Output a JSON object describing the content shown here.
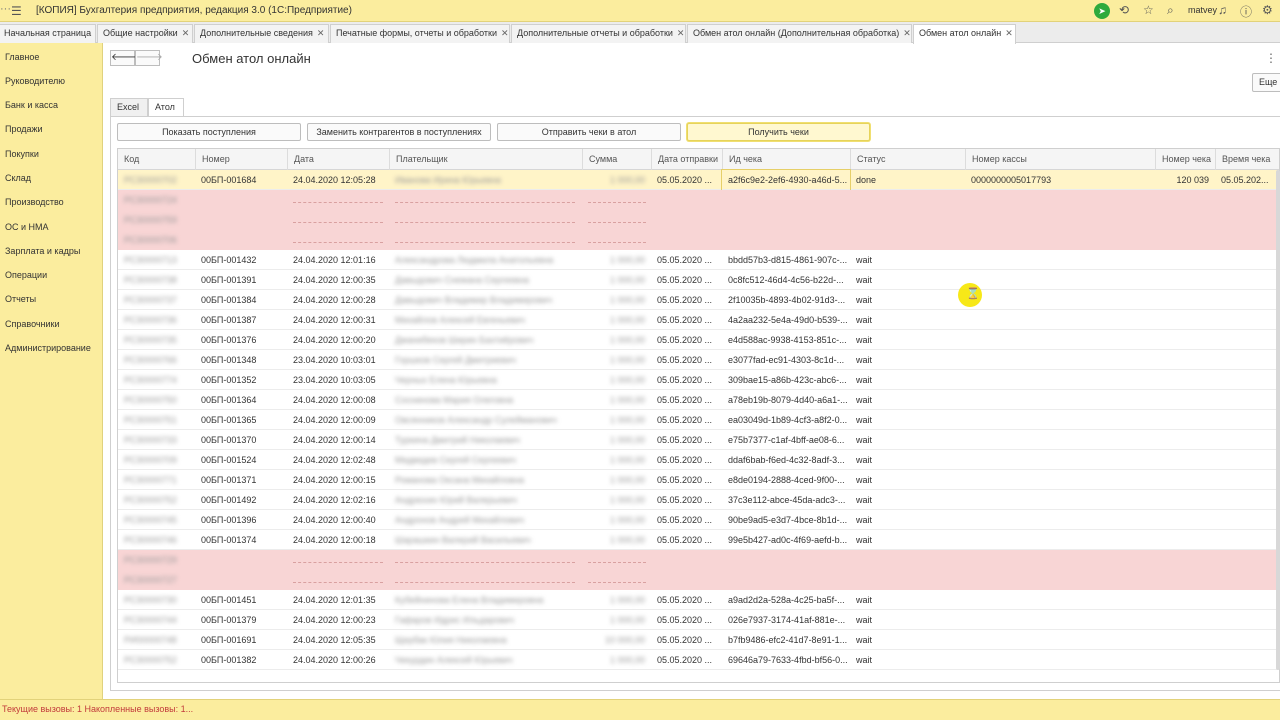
{
  "app": {
    "title": "[КОПИЯ] Бухгалтерия предприятия, редакция 3.0  (1С:Предприятие)",
    "user": "matvey"
  },
  "tabs": [
    {
      "label": "Начальная страница",
      "closable": false
    },
    {
      "label": "Общие настройки",
      "closable": true
    },
    {
      "label": "Дополнительные сведения",
      "closable": true
    },
    {
      "label": "Печатные формы, отчеты и обработки",
      "closable": true
    },
    {
      "label": "Дополнительные отчеты и обработки",
      "closable": true
    },
    {
      "label": "Обмен атол онлайн (Дополнительная обработка)",
      "closable": true
    },
    {
      "label": "Обмен атол онлайн",
      "closable": true,
      "active": true
    }
  ],
  "sidebar": {
    "items": [
      "Главное",
      "Руководителю",
      "Банк и касса",
      "Продажи",
      "Покупки",
      "Склад",
      "Производство",
      "ОС и НМА",
      "Зарплата и кадры",
      "Операции",
      "Отчеты",
      "Справочники",
      "Администрирование"
    ]
  },
  "page": {
    "title": "Обмен атол онлайн",
    "more_label": "Еще"
  },
  "page_tabs": [
    "Excel",
    "Атол"
  ],
  "actions": {
    "show": "Показать поступления",
    "replace": "Заменить контрагентов в поступлениях",
    "send": "Отправить чеки в атол",
    "get": "Получить чеки"
  },
  "table": {
    "columns": [
      "Код",
      "Номер",
      "Дата",
      "Плательщик",
      "Сумма",
      "Дата отправки",
      "Ид чека",
      "Статус",
      "Номер кассы",
      "Номер чека",
      "Время чека"
    ],
    "rows": [
      {
        "code": "РСЗ0000702",
        "num": "00БП-001684",
        "date": "24.04.2020 12:05:28",
        "payer": "Иванова Ирина Юрьевна",
        "sum": "1 000,00",
        "sent": "05.05.2020 ...",
        "id": "a2f6c9e2-2ef6-4930-a46d-5...",
        "status": "done",
        "kassa": "0000000005017793",
        "chek": "120 039",
        "time": "05.05.202...",
        "selected": true
      },
      {
        "kind": "red",
        "codes": [
          "РСЗ0000724",
          "РСЗ0000759",
          "РСЗ0000706"
        ]
      },
      {
        "code": "РСЗ0000713",
        "num": "00БП-001432",
        "date": "24.04.2020 12:01:16",
        "payer": "Александрова Людмила Анатольевна",
        "sum": "1 000,00",
        "sent": "05.05.2020 ...",
        "id": "bbdd57b3-d815-4861-907c-...",
        "status": "wait"
      },
      {
        "code": "РСЗ0000738",
        "num": "00БП-001391",
        "date": "24.04.2020 12:00:35",
        "payer": "Давыдович Снежана Сергеевна",
        "sum": "1 000,00",
        "sent": "05.05.2020 ...",
        "id": "0c8fc512-46d4-4c56-b22d-...",
        "status": "wait"
      },
      {
        "code": "РСЗ0000737",
        "num": "00БП-001384",
        "date": "24.04.2020 12:00:28",
        "payer": "Давыдович Владимир Владимирович",
        "sum": "1 000,00",
        "sent": "05.05.2020 ...",
        "id": "2f10035b-4893-4b02-91d3-...",
        "status": "wait"
      },
      {
        "code": "РСЗ0000736",
        "num": "00БП-001387",
        "date": "24.04.2020 12:00:31",
        "payer": "Михайлов Алексей Евгеньевич",
        "sum": "1 000,00",
        "sent": "05.05.2020 ...",
        "id": "4a2aa232-5e4a-49d0-b539-...",
        "status": "wait"
      },
      {
        "code": "РСЗ0000735",
        "num": "00БП-001376",
        "date": "24.04.2020 12:00:20",
        "payer": "Джанибеков Ширин Бахтиёрович",
        "sum": "1 000,00",
        "sent": "05.05.2020 ...",
        "id": "e4d588ac-9938-4153-851c-...",
        "status": "wait"
      },
      {
        "code": "РСЗ0000766",
        "num": "00БП-001348",
        "date": "23.04.2020 10:03:01",
        "payer": "Горшков Сергей Дмитриевич",
        "sum": "1 000,00",
        "sent": "05.05.2020 ...",
        "id": "e3077fad-ec91-4303-8c1d-...",
        "status": "wait"
      },
      {
        "code": "РСЗ0000774",
        "num": "00БП-001352",
        "date": "23.04.2020 10:03:05",
        "payer": "Черных Елена Юрьевна",
        "sum": "1 000,00",
        "sent": "05.05.2020 ...",
        "id": "309bae15-a86b-423c-abc6-...",
        "status": "wait"
      },
      {
        "code": "РСЗ0000750",
        "num": "00БП-001364",
        "date": "24.04.2020 12:00:08",
        "payer": "Соснинова Мария Олеговна",
        "sum": "1 000,00",
        "sent": "05.05.2020 ...",
        "id": "a78eb19b-8079-4d40-a6a1-...",
        "status": "wait"
      },
      {
        "code": "РСЗ0000751",
        "num": "00БП-001365",
        "date": "24.04.2020 12:00:09",
        "payer": "Овсянников Александр Сулейманович",
        "sum": "1 000,00",
        "sent": "05.05.2020 ...",
        "id": "ea03049d-1b89-4cf3-a8f2-0...",
        "status": "wait"
      },
      {
        "code": "РСЗ0000733",
        "num": "00БП-001370",
        "date": "24.04.2020 12:00:14",
        "payer": "Туркина Дмитрий Николаевич",
        "sum": "1 000,00",
        "sent": "05.05.2020 ...",
        "id": "e75b7377-c1af-4bff-ae08-6...",
        "status": "wait"
      },
      {
        "code": "РСЗ0000709",
        "num": "00БП-001524",
        "date": "24.04.2020 12:02:48",
        "payer": "Медведев Сергей Сергеевич",
        "sum": "1 000,00",
        "sent": "05.05.2020 ...",
        "id": "ddaf6bab-f6ed-4c32-8adf-3...",
        "status": "wait"
      },
      {
        "code": "РСЗ0000771",
        "num": "00БП-001371",
        "date": "24.04.2020 12:00:15",
        "payer": "Романова Оксана Михайловна",
        "sum": "1 000,00",
        "sent": "05.05.2020 ...",
        "id": "e8de0194-2888-4ced-9f00-...",
        "status": "wait"
      },
      {
        "code": "РСЗ0000752",
        "num": "00БП-001492",
        "date": "24.04.2020 12:02:16",
        "payer": "Андрюхин Юрий Валерьевич",
        "sum": "1 000,00",
        "sent": "05.05.2020 ...",
        "id": "37c3e112-abce-45da-adc3-...",
        "status": "wait"
      },
      {
        "code": "РСЗ0000745",
        "num": "00БП-001396",
        "date": "24.04.2020 12:00:40",
        "payer": "Андронов Андрей Михайлович",
        "sum": "1 000,00",
        "sent": "05.05.2020 ...",
        "id": "90be9ad5-e3d7-4bce-8b1d-...",
        "status": "wait"
      },
      {
        "code": "РСЗ0000746",
        "num": "00БП-001374",
        "date": "24.04.2020 12:00:18",
        "payer": "Шарашкин Валерий Васильевич",
        "sum": "1 000,00",
        "sent": "05.05.2020 ...",
        "id": "99e5b427-ad0c-4f69-aefd-b...",
        "status": "wait"
      },
      {
        "kind": "red",
        "codes": [
          "РСЗ0000729",
          "РСЗ0000727"
        ]
      },
      {
        "code": "РСЗ0000730",
        "num": "00БП-001451",
        "date": "24.04.2020 12:01:35",
        "payer": "Кубейнинова Елена Владимировна",
        "sum": "1 000,00",
        "sent": "05.05.2020 ...",
        "id": "a9ad2d2a-528a-4c25-ba5f-...",
        "status": "wait"
      },
      {
        "code": "РСЗ0000744",
        "num": "00БП-001379",
        "date": "24.04.2020 12:00:23",
        "payer": "Гафаров Идрис Ильдарович",
        "sum": "1 000,00",
        "sent": "05.05.2020 ...",
        "id": "026e7937-3174-41af-881e-...",
        "status": "wait"
      },
      {
        "code": "РИ00000748",
        "num": "00БП-001691",
        "date": "24.04.2020 12:05:35",
        "payer": "Щербак Юлия Николаевна",
        "sum": "10 000,00",
        "sent": "05.05.2020 ...",
        "id": "b7fb9486-efc2-41d7-8e91-1...",
        "status": "wait"
      },
      {
        "code": "РСЗ0000752",
        "num": "00БП-001382",
        "date": "24.04.2020 12:00:26",
        "payer": "Чекурдин Алексей Юрьевич",
        "sum": "1 000,00",
        "sent": "05.05.2020 ...",
        "id": "69646a79-7633-4fbd-bf56-0...",
        "status": "wait"
      }
    ]
  },
  "status_bar": {
    "text": "Текущие вызовы: 1   Накопленные вызовы: 1..."
  },
  "colors": {
    "panel_yellow": "#fbed9e",
    "selection": "#fff4c8",
    "error_row": "#f8d5d5",
    "accent_green": "#2eaa3c",
    "cursor_highlight": "#f7e600"
  }
}
